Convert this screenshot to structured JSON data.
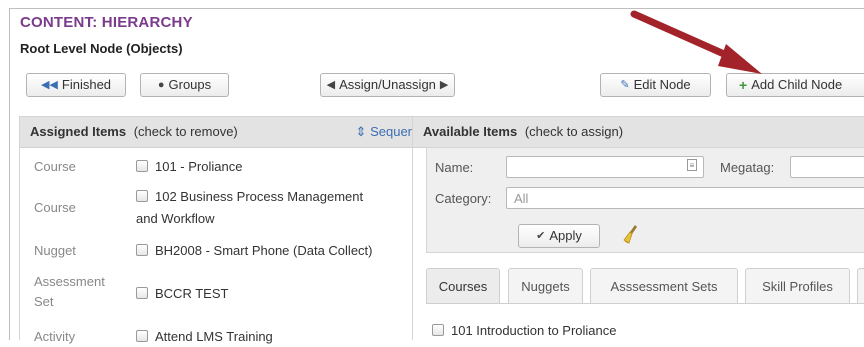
{
  "header": {
    "title": "CONTENT: HIERARCHY",
    "subtitle": "Root Level Node (Objects)"
  },
  "toolbar": {
    "finished_label": "Finished",
    "groups_label": "Groups",
    "assign_label": "Assign/Unassign",
    "edit_node_label": "Edit Node",
    "add_child_label": "Add Child Node"
  },
  "assigned": {
    "header_bold": "Assigned Items",
    "header_hint": "(check to remove)",
    "sequence_label": "Sequer",
    "rows": [
      {
        "type": "Course",
        "item": "101 - Proliance"
      },
      {
        "type": "Course",
        "item_line1": "102 Business Process Management",
        "item_line2": "and Workflow"
      },
      {
        "type": "Nugget",
        "item": "BH2008 - Smart Phone (Data Collect)"
      },
      {
        "type_line1": "Assessment",
        "type_line2": "Set",
        "item": "BCCR TEST"
      },
      {
        "type": "Activity",
        "item": "Attend LMS Training"
      }
    ]
  },
  "available": {
    "header_bold": "Available Items",
    "header_hint": "(check to assign)",
    "filters": {
      "name_label": "Name:",
      "name_value": "",
      "megatag_label": "Megatag:",
      "megatag_value": "",
      "category_label": "Category:",
      "category_value": "All",
      "apply_label": "Apply"
    },
    "tabs": [
      "Courses",
      "Nuggets",
      "Asssessment Sets",
      "Skill Profiles"
    ],
    "active_tab": "Courses",
    "list": [
      "101 Introduction to Proliance"
    ]
  },
  "colors": {
    "title": "#7b3b8c",
    "accent_blue": "#3c6fb2",
    "add_green": "#3f9a3f",
    "arrow": "#a3232a"
  },
  "icons": [
    "rewind-icon",
    "user-icon",
    "caret-left-icon",
    "caret-right-icon",
    "edit-icon",
    "plus-icon",
    "sort-icon",
    "id-card-icon",
    "check-icon",
    "broom-icon"
  ]
}
